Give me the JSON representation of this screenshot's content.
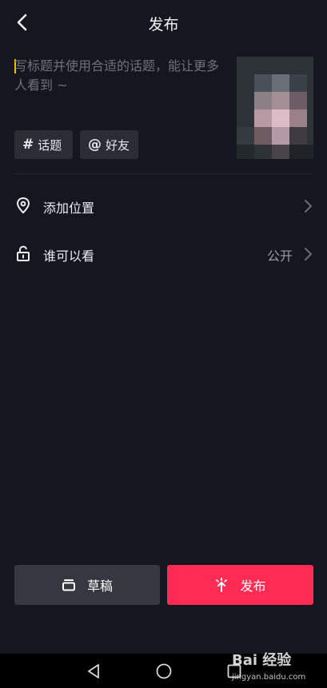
{
  "header": {
    "title": "发布"
  },
  "caption": {
    "placeholder": "写标题并使用合适的话题，能让更多人看到 ~"
  },
  "chips": [
    {
      "symbol": "#",
      "label": "话题"
    },
    {
      "symbol": "@",
      "label": "好友"
    }
  ],
  "rows": {
    "location": {
      "label": "添加位置"
    },
    "visibility": {
      "label": "谁可以看",
      "value": "公开"
    }
  },
  "buttons": {
    "draft": {
      "label": "草稿"
    },
    "publish": {
      "label": "发布"
    }
  },
  "watermark": {
    "brand": "Bai 经验",
    "url": "jingyan.baidu.com"
  },
  "colors": {
    "background": "#15161f",
    "accent": "#fe2c55",
    "chip_bg": "#2b2c36",
    "cursor": "#f3c300"
  },
  "icons": {
    "back": "chevron-left-icon",
    "location": "location-pin-icon",
    "visibility": "unlock-icon",
    "chevron": "chevron-right-icon",
    "draft": "draft-box-icon",
    "publish": "publish-sparkle-icon",
    "nav_back": "triangle-back-icon",
    "nav_home": "circle-home-icon",
    "nav_recent": "square-recent-icon"
  }
}
